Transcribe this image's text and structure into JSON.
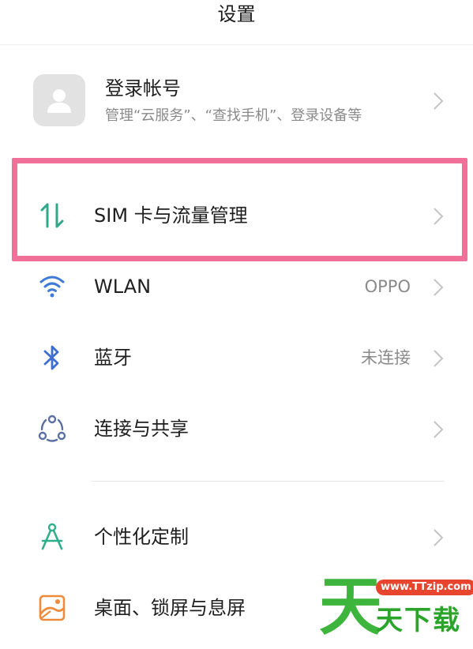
{
  "header": {
    "title": "设置"
  },
  "account": {
    "title": "登录帐号",
    "subtitle": "管理“云服务”、“查找手机”、登录设备等"
  },
  "items": [
    {
      "label": "SIM 卡与流量管理",
      "value": "",
      "icon": "data-transfer-icon",
      "highlighted": true
    },
    {
      "label": "WLAN",
      "value": "OPPO",
      "icon": "wifi-icon"
    },
    {
      "label": "蓝牙",
      "value": "未连接",
      "icon": "bluetooth-icon"
    },
    {
      "label": "连接与共享",
      "value": "",
      "icon": "share-network-icon"
    },
    {
      "label": "个性化定制",
      "value": "",
      "icon": "compass-icon"
    },
    {
      "label": "桌面、锁屏与息屏",
      "value": "",
      "icon": "wallpaper-icon"
    }
  ],
  "watermark": {
    "big_char": "天",
    "url": "www.TTzip.com",
    "text": "天下载"
  },
  "colors": {
    "highlight": "#f0709a",
    "sim_icon": "#2ea88a",
    "wifi_icon": "#3e7bd6",
    "bluetooth_icon": "#3e6fcf",
    "share_icon": "#5b6fa3",
    "compass_icon": "#2fae8c",
    "wallpaper_icon": "#ef8a3a",
    "watermark_green": "#3db53d",
    "watermark_red": "#e8452f"
  }
}
